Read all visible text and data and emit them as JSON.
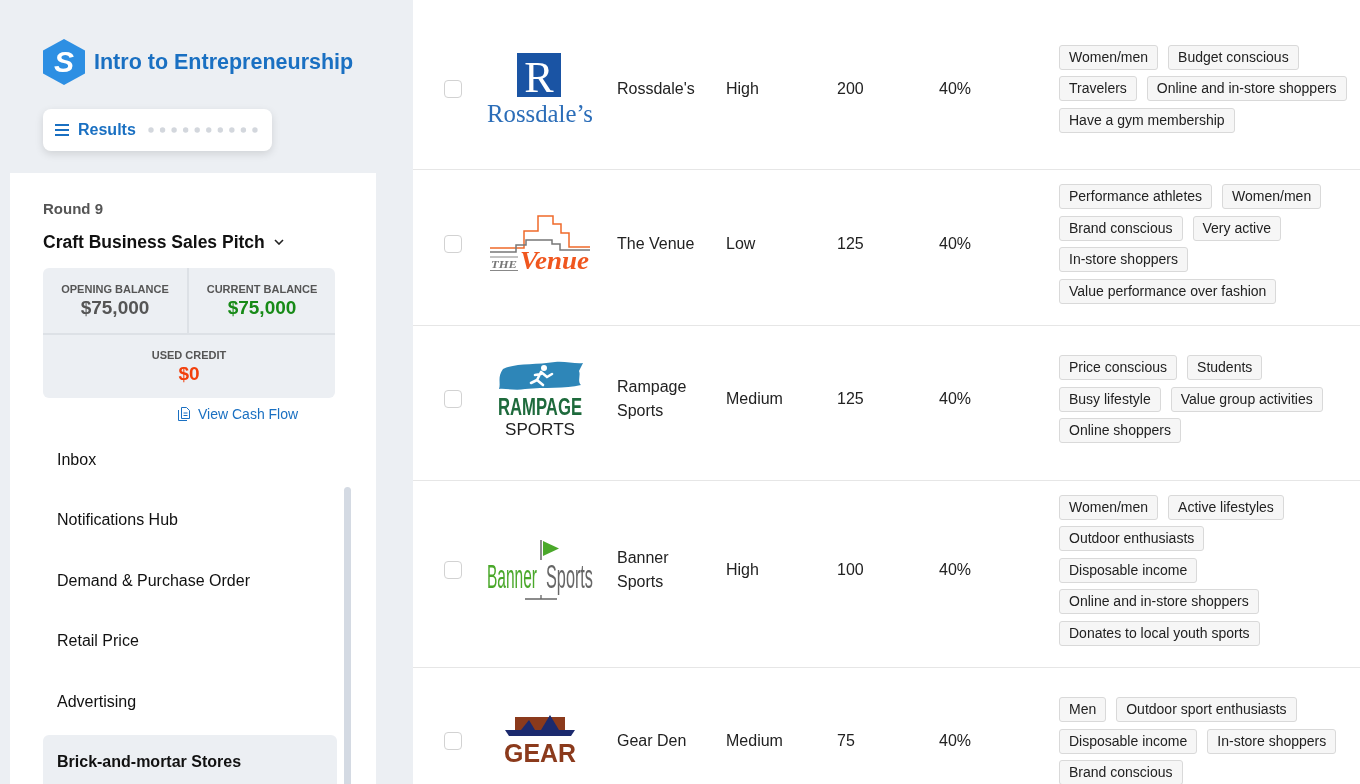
{
  "app": {
    "logo_letter": "S",
    "title": "Intro to Entrepreneurship"
  },
  "results_menu": {
    "label": "Results"
  },
  "round": {
    "label": "Round 9",
    "title": "Craft Business Sales Pitch"
  },
  "balances": [
    {
      "label": "OPENING BALANCE",
      "value": "$75,000",
      "color": "#555555"
    },
    {
      "label": "CURRENT BALANCE",
      "value": "$75,000",
      "color": "#178a17"
    },
    {
      "label": "USED CREDIT",
      "value": "$0",
      "color": "#f2400c"
    }
  ],
  "cash_flow_link": {
    "label": "View Cash Flow"
  },
  "nav": [
    {
      "label": "Inbox",
      "selected": false
    },
    {
      "label": "Notifications Hub",
      "selected": false
    },
    {
      "label": "Demand & Purchase Order",
      "selected": false
    },
    {
      "label": "Retail Price",
      "selected": false
    },
    {
      "label": "Advertising",
      "selected": false
    },
    {
      "label": "Brick-and-mortar Stores",
      "selected": true
    }
  ],
  "stores": [
    {
      "checked": false,
      "logo": {
        "kind": "rossdales",
        "texts": [
          "R",
          "Rossdale’s"
        ]
      },
      "name": "Rossdale's",
      "column_4": "High",
      "column_5": "200",
      "column_6": "40%",
      "tags": [
        "Women/men",
        "Budget conscious",
        "Travelers",
        "Online and in-store shoppers",
        "Have a gym membership"
      ]
    },
    {
      "checked": false,
      "logo": {
        "kind": "venue",
        "texts": [
          "THE",
          "Venue"
        ]
      },
      "name": "The Venue",
      "column_4": "Low",
      "column_5": "125",
      "column_6": "40%",
      "tags": [
        "Performance athletes",
        "Women/men",
        "Brand conscious",
        "Very active",
        "In-store shoppers",
        "Value performance over fashion"
      ]
    },
    {
      "checked": false,
      "logo": {
        "kind": "rampage",
        "texts": [
          "RAMPAGE",
          "SPORTS"
        ]
      },
      "name": "Rampage Sports",
      "column_4": "Medium",
      "column_5": "125",
      "column_6": "40%",
      "tags": [
        "Price conscious",
        "Students",
        "Busy lifestyle",
        "Value group activities",
        "Online shoppers"
      ]
    },
    {
      "checked": false,
      "logo": {
        "kind": "banner",
        "texts": [
          "Banner",
          "Sports"
        ]
      },
      "name": "Banner Sports",
      "column_4": "High",
      "column_5": "100",
      "column_6": "40%",
      "tags": [
        "Women/men",
        "Active lifestyles",
        "Outdoor enthusiasts",
        "Disposable income",
        "Online and in-store shoppers",
        "Donates to local youth sports"
      ]
    },
    {
      "checked": false,
      "logo": {
        "kind": "gear",
        "texts": [
          "GEAR"
        ]
      },
      "name": "Gear Den",
      "column_4": "Medium",
      "column_5": "75",
      "column_6": "40%",
      "tags": [
        "Men",
        "Outdoor sport enthusiasts",
        "Disposable income",
        "In-store shoppers",
        "Brand conscious"
      ]
    }
  ]
}
